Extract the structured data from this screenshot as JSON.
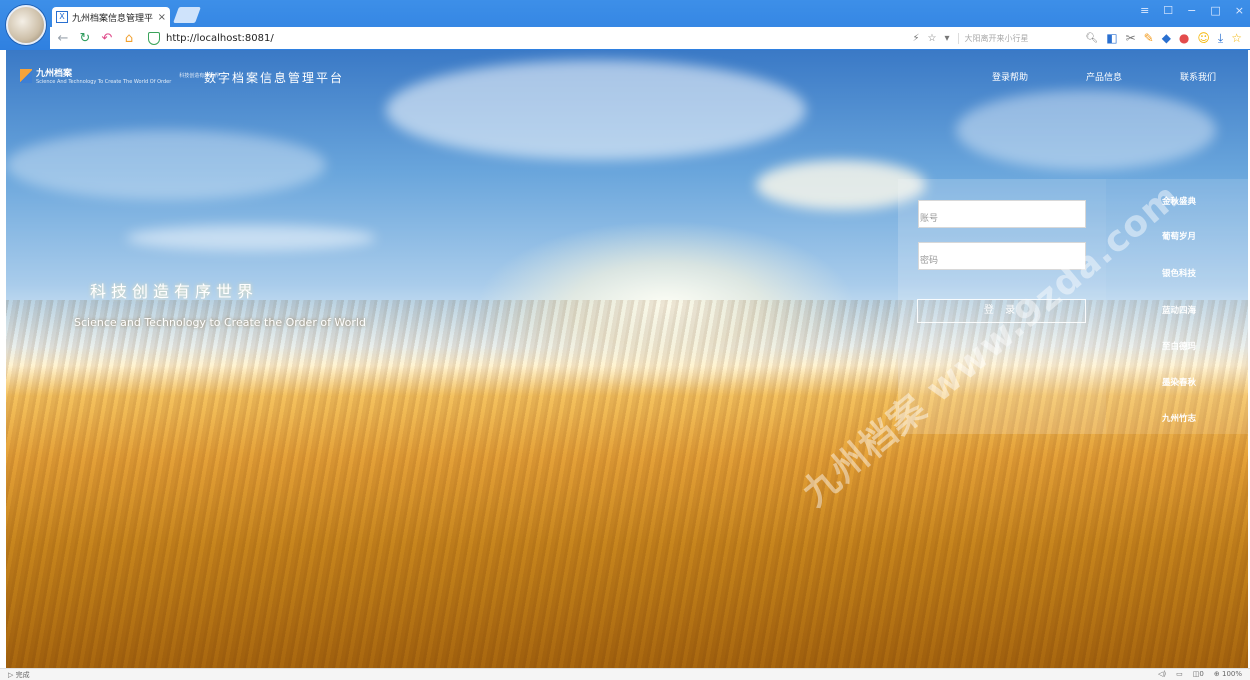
{
  "browser": {
    "tab_title": "九州档案信息管理平台",
    "tab_close": "×",
    "url": "http://localhost:8081/",
    "search_hint": "大阳离开来小行星",
    "window_controls": [
      "≡",
      "☐",
      "−",
      "□",
      "×"
    ]
  },
  "header": {
    "logo_name": "九州档案",
    "logo_sub": "Science And Technology To Create The World Of Order",
    "logo_tag": "科技创造有序世界",
    "platform_title": "数字档案信息管理平台",
    "nav": {
      "help": "登录帮助",
      "product": "产品信息",
      "contact": "联系我们"
    }
  },
  "hero": {
    "slogan_cn": "科技创造有序世界",
    "slogan_en": "Science and Technology to Create the Order of World"
  },
  "login": {
    "username_placeholder": "账号",
    "password_placeholder": "密码",
    "submit_label": "登 录"
  },
  "side_menu": [
    "金秋盛典",
    "葡萄岁月",
    "银色科技",
    "蓝动四海",
    "至白德玛",
    "墨染春秋",
    "九州竹志"
  ],
  "watermark": "九州档案 www.9zda.com",
  "status": {
    "left": "完成",
    "zoom": "100%",
    "count": "0"
  }
}
